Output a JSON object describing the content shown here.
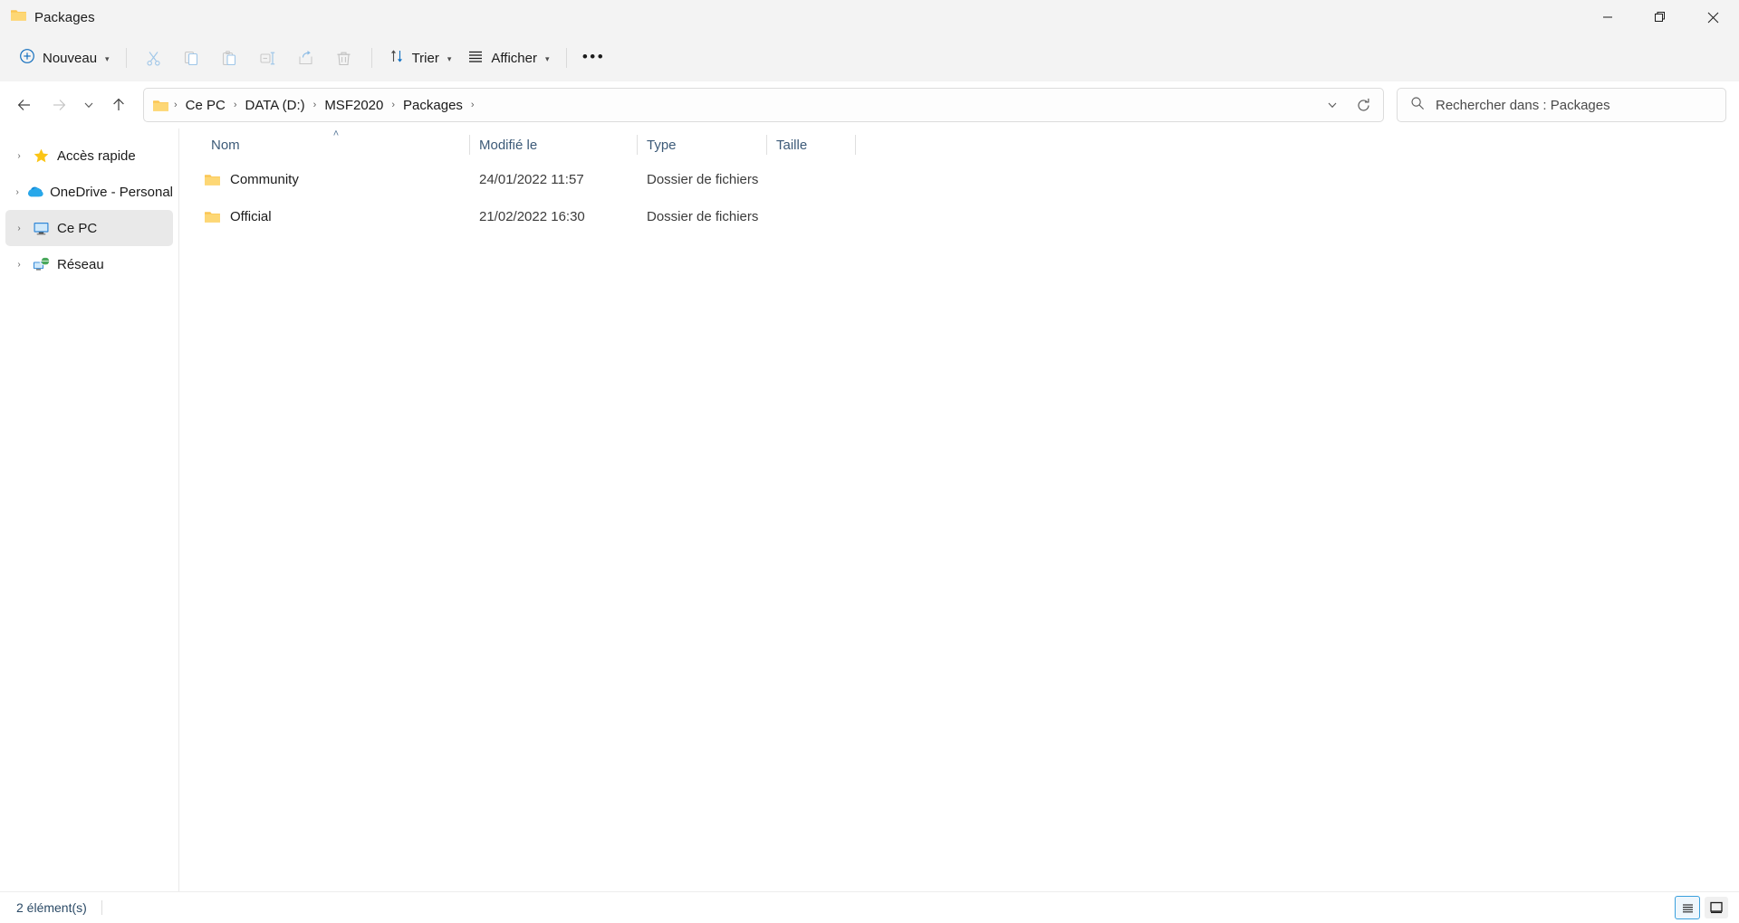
{
  "window": {
    "title": "Packages",
    "title_icon": "folder-icon",
    "controls": [
      {
        "name": "minimize",
        "glyph": "—"
      },
      {
        "name": "restore",
        "glyph": "❐"
      },
      {
        "name": "close",
        "glyph": "✕"
      }
    ]
  },
  "toolbar": {
    "new_label": "Nouveau",
    "new_icon": "plus-circle-icon",
    "icons": [
      {
        "name": "cut-icon",
        "title": "Couper"
      },
      {
        "name": "copy-icon",
        "title": "Copier"
      },
      {
        "name": "paste-icon",
        "title": "Coller"
      },
      {
        "name": "rename-icon",
        "title": "Renommer"
      },
      {
        "name": "share-icon",
        "title": "Partager"
      },
      {
        "name": "delete-icon",
        "title": "Supprimer"
      }
    ],
    "sort_label": "Trier",
    "sort_icon": "sort-arrows-icon",
    "view_label": "Afficher",
    "view_icon": "hamburger-icon",
    "overflow_label": "•••"
  },
  "navigation": {
    "back_icon": "arrow-left-icon",
    "forward_icon": "arrow-right-icon",
    "recent_icon": "chevron-down-icon",
    "up_icon": "arrow-up-icon",
    "dropdown_icon": "chevron-down-icon",
    "refresh_icon": "refresh-icon"
  },
  "breadcrumb": {
    "icon": "folder-icon",
    "items": [
      "Ce PC",
      "DATA (D:)",
      "MSF2020",
      "Packages"
    ],
    "separator": "›"
  },
  "search": {
    "icon": "search-icon",
    "placeholder": "Rechercher dans : Packages"
  },
  "sidebar": {
    "items": [
      {
        "label": "Accès rapide",
        "icon": "star-icon",
        "selected": false,
        "expander": "›"
      },
      {
        "label": "OneDrive - Personal",
        "icon": "cloud-icon",
        "selected": false,
        "expander": "›"
      },
      {
        "label": "Ce PC",
        "icon": "monitor-icon",
        "selected": true,
        "expander": "›"
      },
      {
        "label": "Réseau",
        "icon": "network-icon",
        "selected": false,
        "expander": "›"
      }
    ]
  },
  "columns": [
    {
      "label": "Nom",
      "sorted": "asc",
      "sort_glyph": "˄"
    },
    {
      "label": "Modifié le",
      "sorted": "",
      "sort_glyph": ""
    },
    {
      "label": "Type",
      "sorted": "",
      "sort_glyph": ""
    },
    {
      "label": "Taille",
      "sorted": "",
      "sort_glyph": ""
    }
  ],
  "rows": [
    {
      "icon": "folder-icon",
      "name": "Community",
      "modified": "24/01/2022 11:57",
      "type": "Dossier de fichiers",
      "size": ""
    },
    {
      "icon": "folder-icon",
      "name": "Official",
      "modified": "21/02/2022 16:30",
      "type": "Dossier de fichiers",
      "size": ""
    }
  ],
  "status": {
    "count_text": "2 élément(s)",
    "views": [
      {
        "name": "details-view",
        "active": true
      },
      {
        "name": "large-icons-view",
        "active": false
      }
    ]
  },
  "colors": {
    "chrome": "#f3f3f3",
    "accent": "#3aa0dd",
    "folder": "#fcc76b",
    "header_text": "#3c5a78",
    "selection": "#e9e9e9"
  }
}
